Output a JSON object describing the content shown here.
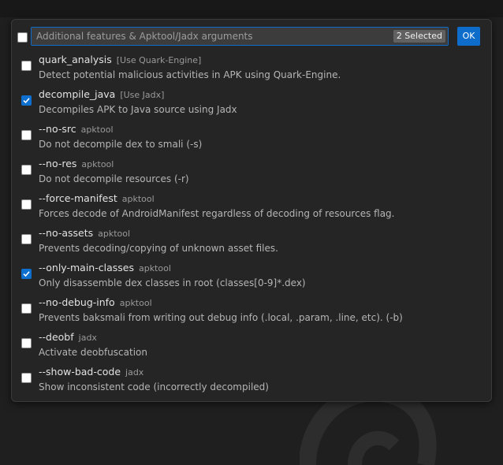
{
  "header": {
    "search_placeholder": "Additional features & Apktool/Jadx arguments",
    "selected_badge": "2 Selected",
    "ok_label": "OK"
  },
  "items": [
    {
      "label": "quark_analysis",
      "tag": "[Use Quark-Engine]",
      "description": "Detect potential malicious activities in APK using Quark-Engine.",
      "checked": false
    },
    {
      "label": "decompile_java",
      "tag": "[Use Jadx]",
      "description": "Decompiles APK to Java source using Jadx",
      "checked": true
    },
    {
      "label": "--no-src",
      "tag": "apktool",
      "description": "Do not decompile dex to smali (-s)",
      "checked": false
    },
    {
      "label": "--no-res",
      "tag": "apktool",
      "description": "Do not decompile resources (-r)",
      "checked": false
    },
    {
      "label": "--force-manifest",
      "tag": "apktool",
      "description": "Forces decode of AndroidManifest regardless of decoding of resources flag.",
      "checked": false
    },
    {
      "label": "--no-assets",
      "tag": "apktool",
      "description": "Prevents decoding/copying of unknown asset files.",
      "checked": false
    },
    {
      "label": "--only-main-classes",
      "tag": "apktool",
      "description": "Only disassemble dex classes in root (classes[0-9]*.dex)",
      "checked": true
    },
    {
      "label": "--no-debug-info",
      "tag": "apktool",
      "description": "Prevents baksmali from writing out debug info (.local, .param, .line, etc). (-b)",
      "checked": false
    },
    {
      "label": "--deobf",
      "tag": "jadx",
      "description": "Activate deobfuscation",
      "checked": false
    },
    {
      "label": "--show-bad-code",
      "tag": "jadx",
      "description": "Show inconsistent code (incorrectly decompiled)",
      "checked": false
    }
  ]
}
